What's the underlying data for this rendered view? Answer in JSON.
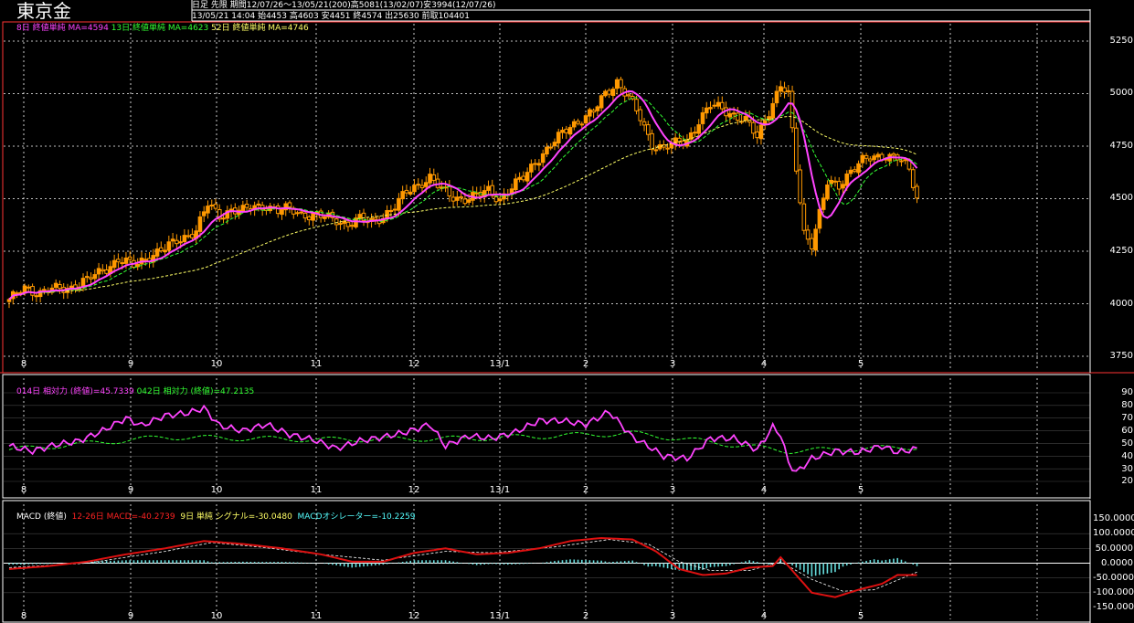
{
  "header": {
    "title": "東京金",
    "line1": "日足 先限 期間12/07/26〜13/05/21(200)高5081(13/02/07)安3994(12/07/26)",
    "line2": "13/05/21 14:04 始4453 高4603 安4451 終4574 出25630 前取104401"
  },
  "legends": {
    "price": [
      {
        "text": "8日 終値単純 MA=4594",
        "color": "#ff44ff"
      },
      {
        "text": "13日 終値単純 MA=4623",
        "color": "#33ff33"
      },
      {
        "text": "52日 終値単純 MA=4746",
        "color": "#ffff66"
      }
    ],
    "rsi": [
      {
        "text": "014日 相対力 (終値)=45.7339",
        "color": "#ff44ff"
      },
      {
        "text": "042日 相対力 (終値)=47.2135",
        "color": "#33ff33"
      }
    ],
    "macd": [
      {
        "text": "MACD (終値)",
        "color": "#ffffff"
      },
      {
        "text": "12-26日 MACD=-40.2739",
        "color": "#ff2222"
      },
      {
        "text": "9日 単純 シグナル=-30.0480",
        "color": "#ffff66"
      },
      {
        "text": "MACDオシレーター=-10.2259",
        "color": "#55ffff"
      }
    ]
  },
  "colors": {
    "candle_up": "#ff9900",
    "candle_down": "#ff9900",
    "ma8": "#ff44ff",
    "ma13": "#33ff33",
    "ma52": "#ffff66",
    "grid": "#ffffff",
    "border": "#ff3333",
    "macd": "#dd1111",
    "signal": "#ffffff",
    "osc": "#66dddd"
  },
  "chart_data": [
    {
      "type": "candlestick",
      "title": "東京金",
      "ylim": [
        3750,
        5250
      ],
      "y_ticks": [
        "5250",
        "5000",
        "4750",
        "4500",
        "4250",
        "4000",
        "3750"
      ],
      "x_ticks": [
        "8",
        "9",
        "10",
        "11",
        "12",
        "13/1",
        "2",
        "3",
        "4",
        "5"
      ],
      "close_knots": [
        [
          0,
          4010
        ],
        [
          4,
          4080
        ],
        [
          8,
          4050
        ],
        [
          12,
          4070
        ],
        [
          16,
          4080
        ],
        [
          20,
          4110
        ],
        [
          24,
          4160
        ],
        [
          28,
          4210
        ],
        [
          32,
          4180
        ],
        [
          36,
          4230
        ],
        [
          40,
          4260
        ],
        [
          44,
          4310
        ],
        [
          48,
          4350
        ],
        [
          51,
          4470
        ],
        [
          54,
          4420
        ],
        [
          57,
          4450
        ],
        [
          60,
          4440
        ],
        [
          63,
          4460
        ],
        [
          66,
          4470
        ],
        [
          69,
          4440
        ],
        [
          72,
          4450
        ],
        [
          75,
          4430
        ],
        [
          78,
          4420
        ],
        [
          81,
          4410
        ],
        [
          84,
          4400
        ],
        [
          87,
          4380
        ],
        [
          90,
          4400
        ],
        [
          93,
          4390
        ],
        [
          96,
          4420
        ],
        [
          99,
          4460
        ],
        [
          102,
          4530
        ],
        [
          105,
          4570
        ],
        [
          108,
          4600
        ],
        [
          111,
          4540
        ],
        [
          114,
          4510
        ],
        [
          117,
          4500
        ],
        [
          120,
          4510
        ],
        [
          123,
          4540
        ],
        [
          126,
          4500
        ],
        [
          129,
          4550
        ],
        [
          132,
          4600
        ],
        [
          135,
          4680
        ],
        [
          138,
          4730
        ],
        [
          141,
          4790
        ],
        [
          144,
          4850
        ],
        [
          147,
          4880
        ],
        [
          150,
          4910
        ],
        [
          153,
          5000
        ],
        [
          156,
          5060
        ],
        [
          159,
          4980
        ],
        [
          162,
          4880
        ],
        [
          165,
          4760
        ],
        [
          168,
          4740
        ],
        [
          171,
          4760
        ],
        [
          174,
          4780
        ],
        [
          177,
          4870
        ],
        [
          180,
          4940
        ],
        [
          183,
          4930
        ],
        [
          186,
          4900
        ],
        [
          189,
          4870
        ],
        [
          192,
          4790
        ],
        [
          195,
          4920
        ],
        [
          198,
          5040
        ],
        [
          200,
          4990
        ],
        [
          202,
          4640
        ],
        [
          204,
          4340
        ],
        [
          206,
          4290
        ],
        [
          208,
          4430
        ],
        [
          210,
          4570
        ],
        [
          213,
          4560
        ],
        [
          216,
          4640
        ],
        [
          219,
          4680
        ],
        [
          222,
          4690
        ],
        [
          225,
          4710
        ],
        [
          228,
          4700
        ],
        [
          231,
          4630
        ],
        [
          233,
          4500
        ]
      ],
      "candle_count": 234,
      "ma8_last": 4594,
      "ma13_last": 4623,
      "ma52_last": 4746
    },
    {
      "type": "line",
      "title": "相対力",
      "ylim": [
        20,
        90
      ],
      "y_ticks": [
        "90",
        "80",
        "70",
        "60",
        "50",
        "40",
        "30",
        "20"
      ],
      "x_ticks": [
        "8",
        "9",
        "10",
        "11",
        "12",
        "13/1",
        "2",
        "3",
        "4",
        "5"
      ],
      "rsi14_knots": [
        [
          0,
          48
        ],
        [
          6,
          44
        ],
        [
          12,
          49
        ],
        [
          18,
          52
        ],
        [
          24,
          60
        ],
        [
          30,
          70
        ],
        [
          34,
          64
        ],
        [
          40,
          72
        ],
        [
          46,
          74
        ],
        [
          50,
          78
        ],
        [
          54,
          64
        ],
        [
          60,
          60
        ],
        [
          66,
          65
        ],
        [
          72,
          57
        ],
        [
          78,
          53
        ],
        [
          84,
          46
        ],
        [
          90,
          52
        ],
        [
          96,
          55
        ],
        [
          102,
          59
        ],
        [
          108,
          65
        ],
        [
          112,
          48
        ],
        [
          118,
          56
        ],
        [
          124,
          54
        ],
        [
          130,
          59
        ],
        [
          136,
          68
        ],
        [
          142,
          68
        ],
        [
          148,
          65
        ],
        [
          154,
          75
        ],
        [
          160,
          55
        ],
        [
          164,
          48
        ],
        [
          168,
          40
        ],
        [
          174,
          38
        ],
        [
          180,
          54
        ],
        [
          186,
          54
        ],
        [
          192,
          45
        ],
        [
          196,
          63
        ],
        [
          198,
          57
        ],
        [
          200,
          35
        ],
        [
          202,
          27
        ],
        [
          206,
          38
        ],
        [
          212,
          44
        ],
        [
          218,
          43
        ],
        [
          224,
          48
        ],
        [
          228,
          43
        ],
        [
          233,
          45.73
        ]
      ],
      "rsi42_knots": [
        [
          0,
          45
        ],
        [
          40,
          55
        ],
        [
          80,
          53
        ],
        [
          120,
          54
        ],
        [
          160,
          58
        ],
        [
          200,
          44
        ],
        [
          233,
          47.21
        ]
      ]
    },
    {
      "type": "bar",
      "title": "MACD (終値)",
      "ylim": [
        -150,
        150
      ],
      "y_ticks": [
        "150.0000",
        "100.0000",
        "50.0000",
        "0.0000",
        "-50.0000",
        "-100.0000",
        "-150.0000"
      ],
      "x_ticks": [
        "8",
        "9",
        "10",
        "11",
        "12",
        "13/1",
        "2",
        "3",
        "4",
        "5"
      ],
      "macd_knots": [
        [
          0,
          -20
        ],
        [
          10,
          -10
        ],
        [
          20,
          5
        ],
        [
          30,
          30
        ],
        [
          40,
          50
        ],
        [
          50,
          75
        ],
        [
          60,
          65
        ],
        [
          70,
          50
        ],
        [
          80,
          30
        ],
        [
          88,
          5
        ],
        [
          96,
          5
        ],
        [
          104,
          35
        ],
        [
          112,
          50
        ],
        [
          120,
          30
        ],
        [
          128,
          35
        ],
        [
          136,
          50
        ],
        [
          144,
          75
        ],
        [
          152,
          85
        ],
        [
          160,
          80
        ],
        [
          166,
          40
        ],
        [
          172,
          -20
        ],
        [
          178,
          -40
        ],
        [
          184,
          -35
        ],
        [
          190,
          -15
        ],
        [
          196,
          -10
        ],
        [
          198,
          20
        ],
        [
          202,
          -40
        ],
        [
          206,
          -100
        ],
        [
          212,
          -115
        ],
        [
          218,
          -90
        ],
        [
          224,
          -70
        ],
        [
          228,
          -40
        ],
        [
          233,
          -40.27
        ]
      ],
      "signal_knots": [
        [
          0,
          -15
        ],
        [
          20,
          0
        ],
        [
          40,
          40
        ],
        [
          52,
          70
        ],
        [
          64,
          55
        ],
        [
          80,
          30
        ],
        [
          96,
          10
        ],
        [
          112,
          40
        ],
        [
          124,
          35
        ],
        [
          140,
          55
        ],
        [
          154,
          80
        ],
        [
          164,
          65
        ],
        [
          172,
          5
        ],
        [
          180,
          -25
        ],
        [
          190,
          -25
        ],
        [
          198,
          5
        ],
        [
          206,
          -55
        ],
        [
          214,
          -95
        ],
        [
          222,
          -90
        ],
        [
          233,
          -30.05
        ]
      ],
      "osc_last": -10.2259
    }
  ]
}
